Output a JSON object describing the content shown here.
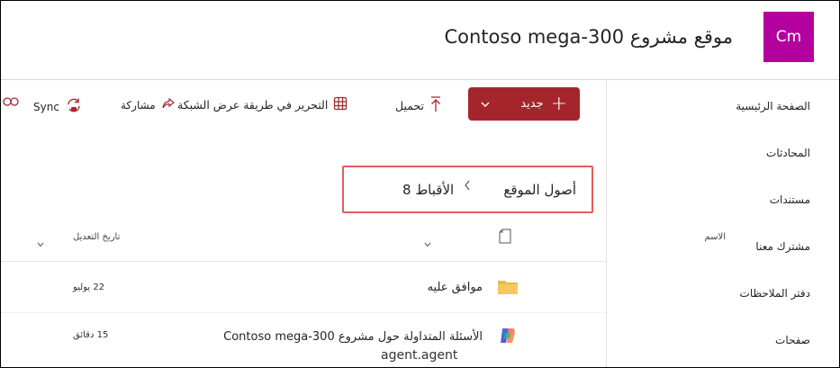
{
  "site": {
    "logo_initials": "Cm",
    "title": "موقع مشروع Contoso mega-300",
    "brand_color": "#b4009e"
  },
  "nav": {
    "items": [
      {
        "label": "الصفحة الرئيسية"
      },
      {
        "label": "المحادثات"
      },
      {
        "label": "مستندات"
      },
      {
        "label": "مشترك معنا"
      },
      {
        "label": "دفتر الملاحظات"
      },
      {
        "label": "صفحات"
      }
    ]
  },
  "command_bar": {
    "new_label": "جديد",
    "new_color": "#a4262c",
    "upload_label": "تحميل",
    "edit_grid_label": "التحرير في طريقة عرض الشبكة",
    "share_label": "مشاركة",
    "sync_label": "Sync"
  },
  "breadcrumb": {
    "root": "أصول الموقع",
    "current": "الأقباط 8",
    "highlight_color": "#e35c5c"
  },
  "list": {
    "columns": {
      "name": "الاسم",
      "modified": "تاريخ التعديل"
    },
    "rows": [
      {
        "name": "موافق عليه",
        "modified": "22 يوليو",
        "icon": "folder-icon"
      },
      {
        "name": "الأسئلة المتداولة حول مشروع Contoso mega-300",
        "modified": "15 دقائق",
        "subtitle": "agent.agent",
        "icon": "copilot-agent-icon"
      }
    ]
  }
}
